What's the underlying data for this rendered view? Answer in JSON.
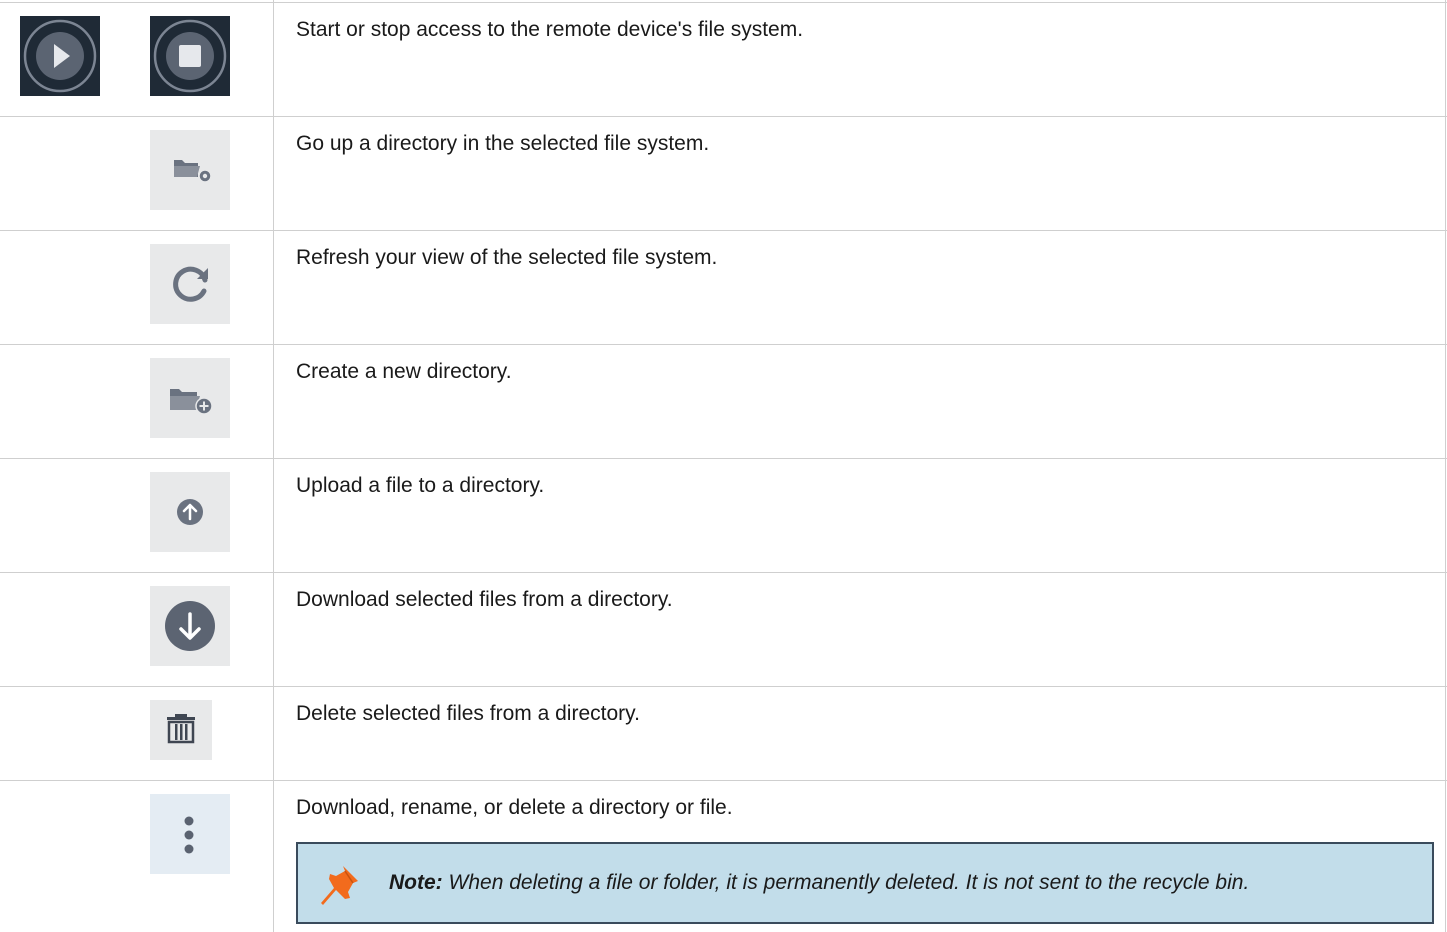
{
  "rows": [
    {
      "description": "Start or stop access to the remote device's file system.",
      "icons": [
        "play-circle-icon",
        "stop-circle-icon"
      ]
    },
    {
      "description": "Go up a directory in the selected file system.",
      "icons": [
        "folder-up-icon"
      ]
    },
    {
      "description": "Refresh your view of the selected file system.",
      "icons": [
        "refresh-icon"
      ]
    },
    {
      "description": "Create a new directory.",
      "icons": [
        "folder-add-icon"
      ]
    },
    {
      "description": "Upload a file to a directory.",
      "icons": [
        "upload-icon"
      ]
    },
    {
      "description": "Download selected files from a directory.",
      "icons": [
        "download-icon"
      ]
    },
    {
      "description": "Delete selected files from a directory.",
      "icons": [
        "trash-icon"
      ]
    },
    {
      "description": "Download, rename, or delete a directory or file.",
      "icons": [
        "more-vertical-icon"
      ]
    }
  ],
  "note": {
    "label": "Note:",
    "text": "When deleting a file or folder, it is permanently deleted. It is not sent to the recycle bin.",
    "icon": "pushpin-icon"
  },
  "colors": {
    "icon_gray": "#6a7280",
    "icon_bg": "#e8e9ea",
    "dark_icon_bg": "#1f2a36",
    "note_bg": "#c2ddea",
    "note_border": "#3a4b5c",
    "pin_orange": "#f26b1d"
  }
}
